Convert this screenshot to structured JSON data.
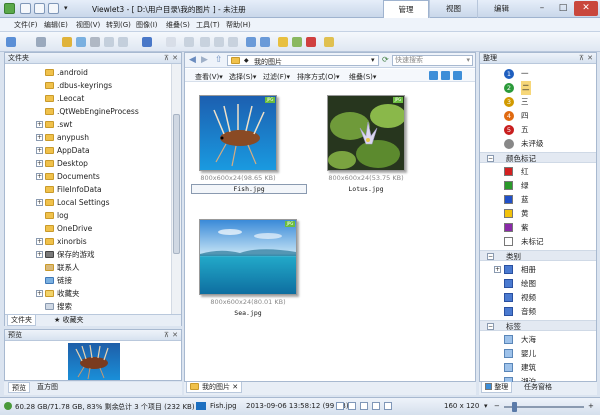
{
  "window": {
    "title": "Viewlet3 - [ D:\\用户目录\\我的图片 ] - 未注册",
    "ribbon_tabs": [
      {
        "label": "管理",
        "active": true
      },
      {
        "label": "视图",
        "active": false
      },
      {
        "label": "编辑",
        "active": false
      }
    ]
  },
  "menu": [
    "文件(F)",
    "编辑(E)",
    "视图(V)",
    "转到(G)",
    "图像(I)",
    "维叠(S)",
    "工具(T)",
    "帮助(H)"
  ],
  "left_panel": {
    "header": "文件夹",
    "folders": [
      {
        "name": ".android",
        "expandable": false
      },
      {
        "name": ".dbus-keyrings",
        "expandable": false
      },
      {
        "name": ".Leocat",
        "expandable": false
      },
      {
        "name": ".QtWebEngineProcess",
        "expandable": false
      },
      {
        "name": ".swt",
        "expandable": true
      },
      {
        "name": "anypush",
        "expandable": true
      },
      {
        "name": "AppData",
        "expandable": true
      },
      {
        "name": "Desktop",
        "expandable": true
      },
      {
        "name": "Documents",
        "expandable": true
      },
      {
        "name": "FileInfoData",
        "expandable": false
      },
      {
        "name": "Local Settings",
        "expandable": true
      },
      {
        "name": "log",
        "expandable": false
      },
      {
        "name": "OneDrive",
        "expandable": false
      },
      {
        "name": "xinorbis",
        "expandable": true
      },
      {
        "name": "保存的游戏",
        "expandable": true
      },
      {
        "name": "联系人",
        "expandable": false
      },
      {
        "name": "链接",
        "expandable": false
      },
      {
        "name": "收藏夹",
        "expandable": true
      },
      {
        "name": "搜索",
        "expandable": false
      }
    ],
    "tabs": [
      "文件夹",
      "收藏夹"
    ],
    "preview_header": "预览",
    "bottom_tabs": [
      "预览",
      "直方图"
    ]
  },
  "center": {
    "breadcrumb": "我的图片",
    "search_placeholder": "快速搜索",
    "view_menu": [
      "查看(V)",
      "选择(S)",
      "过滤(F)",
      "排序方式(O)",
      "维叠(S)"
    ],
    "thumbnails": [
      {
        "caption": "800x600x24(98.65 KB)",
        "name": "Fish.jpg",
        "selected": true
      },
      {
        "caption": "800x600x24(53.75 KB)",
        "name": "Lotus.jpg",
        "selected": false
      },
      {
        "caption": "800x600x24(80.01 KB)",
        "name": "Sea.jpg",
        "selected": false
      }
    ],
    "doc_tab": "我的图片"
  },
  "right_panel": {
    "header": "整理",
    "ratings": [
      {
        "label": "一",
        "color": "#1f5fbf"
      },
      {
        "label": "二",
        "color": "#2b9a3a"
      },
      {
        "label": "三",
        "color": "#d19a00"
      },
      {
        "label": "四",
        "color": "#e06a10"
      },
      {
        "label": "五",
        "color": "#c81e1e"
      },
      {
        "label": "未评级",
        "color": "#888888"
      }
    ],
    "color_section": "颜色标记",
    "colors": [
      {
        "label": "红",
        "color": "#d42020"
      },
      {
        "label": "绿",
        "color": "#2a9a2a"
      },
      {
        "label": "蓝",
        "color": "#2050c8"
      },
      {
        "label": "黄",
        "color": "#f2c20a"
      },
      {
        "label": "紫",
        "color": "#8a2aa8"
      },
      {
        "label": "未标记",
        "color": "#ffffff"
      }
    ],
    "category_section": "类别",
    "categories": [
      "相册",
      "绘图",
      "视频",
      "音频"
    ],
    "tag_section": "标签",
    "tags": [
      "大海",
      "婴儿",
      "建筑",
      "湖泊"
    ],
    "bottom_tabs": [
      "整理",
      "任务窗格"
    ]
  },
  "status": {
    "disk": "60.28 GB/71.78 GB, 83% 剩余",
    "count": "总计 3 个项目 (232 KB)",
    "file": "Fish.jpg",
    "date": "2013-09-06 13:58:12 (99 KB)",
    "thumb_size": "160 x 120"
  }
}
